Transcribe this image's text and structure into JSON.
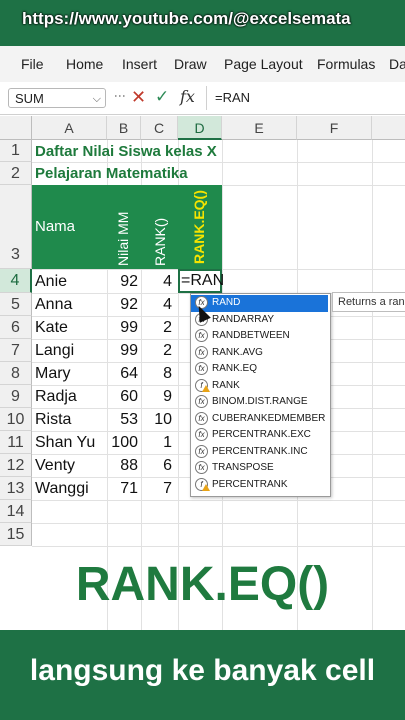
{
  "overlay": {
    "url": "https://www.youtube.com/@excelsemata"
  },
  "ribbon": {
    "tabs": [
      "File",
      "Home",
      "Insert",
      "Draw",
      "Page Layout",
      "Formulas",
      "Da"
    ]
  },
  "formula_bar": {
    "name_box": "SUM",
    "formula": "=RAN"
  },
  "columns": [
    "A",
    "B",
    "C",
    "D",
    "E",
    "F"
  ],
  "rows": [
    "1",
    "2",
    "3",
    "4",
    "5",
    "6",
    "7",
    "8",
    "9",
    "10",
    "11",
    "12",
    "13",
    "14",
    "15"
  ],
  "sheet": {
    "title1": "Daftar Nilai Siswa kelas X",
    "title2": "Pelajaran Matematika",
    "header": {
      "nama": "Nama",
      "nilai": "Nilai MM",
      "rank": "RANK()",
      "rankeq": "RANK.EQ()"
    },
    "students": [
      {
        "name": "Anie",
        "score": "92",
        "rank": "4"
      },
      {
        "name": "Anna",
        "score": "92",
        "rank": "4"
      },
      {
        "name": "Kate",
        "score": "99",
        "rank": "2"
      },
      {
        "name": "Langi",
        "score": "99",
        "rank": "2"
      },
      {
        "name": "Mary",
        "score": "64",
        "rank": "8"
      },
      {
        "name": "Radja",
        "score": "60",
        "rank": "9"
      },
      {
        "name": "Rista",
        "score": "53",
        "rank": "10"
      },
      {
        "name": "Shan Yu",
        "score": "100",
        "rank": "1"
      },
      {
        "name": "Venty",
        "score": "88",
        "rank": "6"
      },
      {
        "name": "Wanggi",
        "score": "71",
        "rank": "7"
      }
    ],
    "editing": "=RAN"
  },
  "autocomplete": {
    "items": [
      "RAND",
      "RANDARRAY",
      "RANDBETWEEN",
      "RANK.AVG",
      "RANK.EQ",
      "RANK",
      "BINOM.DIST.RANGE",
      "CUBERANKEDMEMBER",
      "PERCENTRANK.EXC",
      "PERCENTRANK.INC",
      "TRANSPOSE",
      "PERCENTRANK"
    ],
    "tooltip": "Returns a ran"
  },
  "banner": {
    "big": "RANK.EQ()",
    "bottom": "langsung ke banyak cell"
  }
}
